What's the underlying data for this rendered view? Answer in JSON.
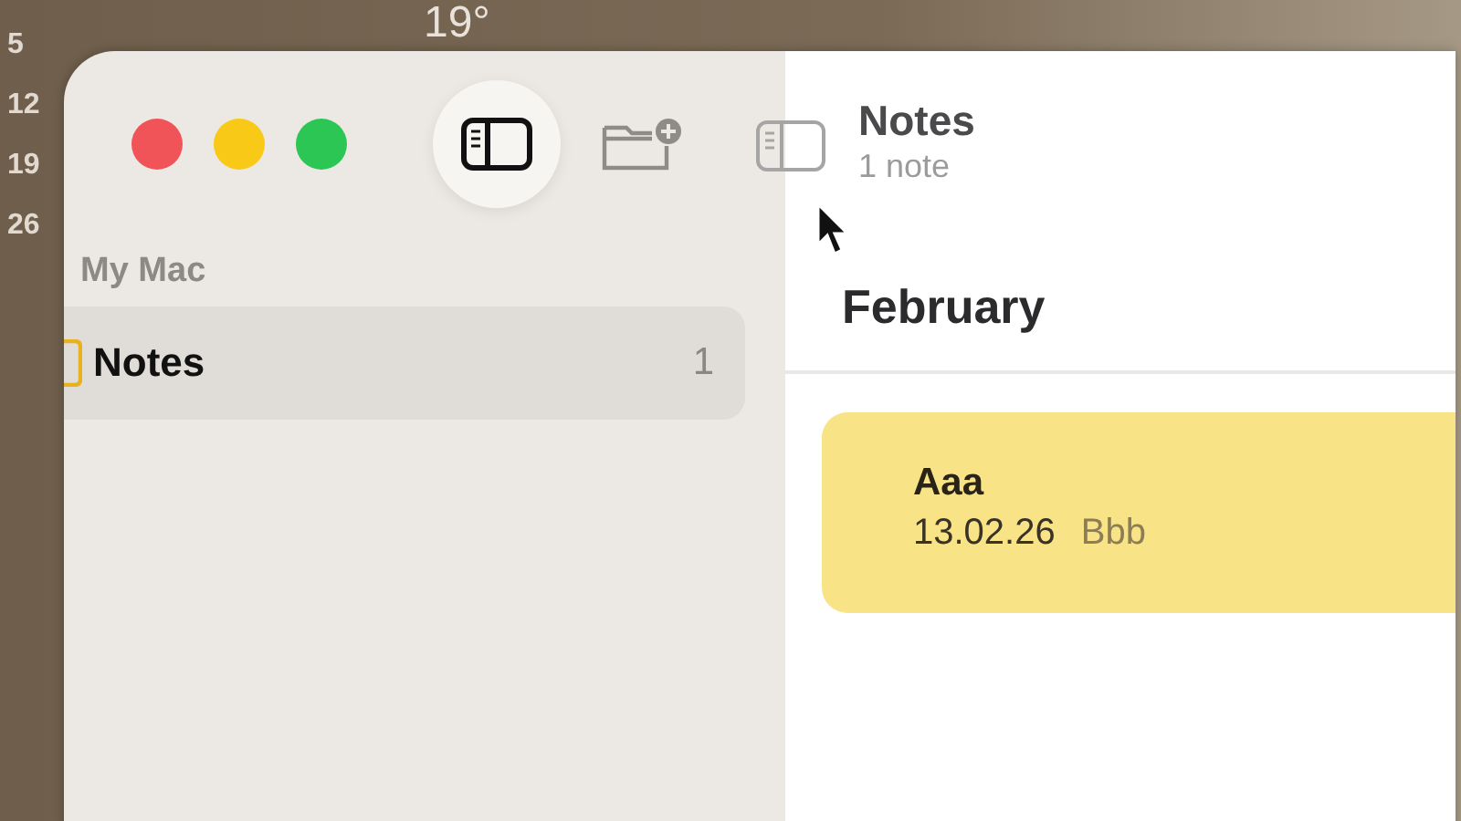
{
  "desktop": {
    "calendar_days": [
      "5",
      "12",
      "19",
      "26"
    ],
    "weather_temperature": "19°"
  },
  "sidebar": {
    "section": "My Mac",
    "items": [
      {
        "label": "Notes",
        "count": "1",
        "selected": true
      }
    ]
  },
  "note_list": {
    "title": "Notes",
    "subtitle": "1 note",
    "groups": [
      {
        "heading": "February",
        "notes": [
          {
            "title": "Aaa",
            "date": "13.02.26",
            "preview": "Bbb",
            "selected": true
          }
        ]
      }
    ]
  }
}
